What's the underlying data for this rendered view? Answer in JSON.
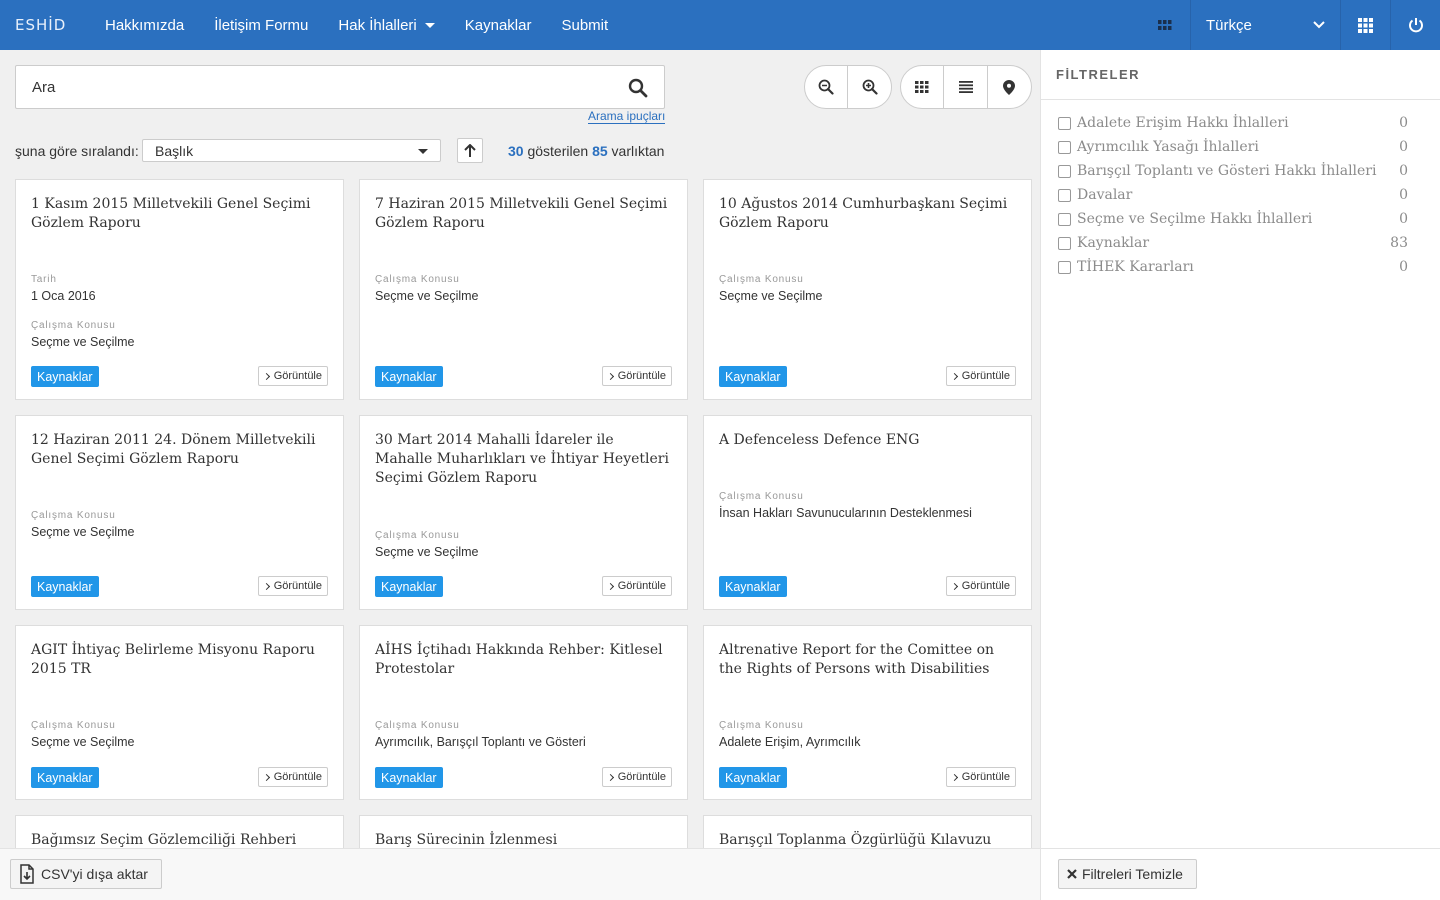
{
  "header": {
    "brand": "ESHİD",
    "nav": [
      "Hakkımızda",
      "İletişim Formu",
      "Hak İhlalleri",
      "Kaynaklar",
      "Submit"
    ],
    "language": "Türkçe",
    "icons": [
      "grid-small-icon",
      "chevron-down-icon",
      "apps-icon",
      "power-icon"
    ]
  },
  "search": {
    "placeholder": "Ara",
    "tips": "Arama ipuçları"
  },
  "sort": {
    "label": "şuna göre sıralandı:",
    "value": "Başlık"
  },
  "results": {
    "shown": "30",
    "mid": " gösterilen ",
    "total": "85",
    "suffix": " varlıktan"
  },
  "cards": [
    {
      "title": "1 Kasım 2015 Milletvekili Genel Seçimi Gözlem Raporu",
      "date_label": "Tarih",
      "date": "1 Oca 2016",
      "subject_label": "Çalışma Konusu",
      "subject": "Seçme ve Seçilme",
      "tag": "Kaynaklar",
      "view": "Görüntüle"
    },
    {
      "title": "7 Haziran 2015 Milletvekili Genel Seçimi Gözlem Raporu",
      "subject_label": "Çalışma Konusu",
      "subject": "Seçme ve Seçilme",
      "tag": "Kaynaklar",
      "view": "Görüntüle"
    },
    {
      "title": "10 Ağustos 2014 Cumhurbaşkanı Seçimi Gözlem Raporu",
      "subject_label": "Çalışma Konusu",
      "subject": "Seçme ve Seçilme",
      "tag": "Kaynaklar",
      "view": "Görüntüle"
    },
    {
      "title": "12 Haziran 2011 24. Dönem Milletvekili Genel Seçimi Gözlem Raporu",
      "subject_label": "Çalışma Konusu",
      "subject": "Seçme ve Seçilme",
      "tag": "Kaynaklar",
      "view": "Görüntüle"
    },
    {
      "title": "30 Mart 2014 Mahalli İdareler ile Mahalle Muharlıkları ve İhtiyar Heyetleri Seçimi Gözlem Raporu",
      "subject_label": "Çalışma Konusu",
      "subject": "Seçme ve Seçilme",
      "tag": "Kaynaklar",
      "view": "Görüntüle"
    },
    {
      "title": "A Defenceless Defence ENG",
      "subject_label": "Çalışma Konusu",
      "subject": "İnsan Hakları Savunucularının Desteklenmesi",
      "tag": "Kaynaklar",
      "view": "Görüntüle"
    },
    {
      "title": "AGIT İhtiyaç Belirleme Misyonu Raporu 2015 TR",
      "subject_label": "Çalışma Konusu",
      "subject": "Seçme ve Seçilme",
      "tag": "Kaynaklar",
      "view": "Görüntüle"
    },
    {
      "title": "AİHS İçtihadı Hakkında Rehber: Kitlesel Protestolar",
      "subject_label": "Çalışma Konusu",
      "subject": "Ayrımcılık, Barışçıl Toplantı ve Gösteri",
      "tag": "Kaynaklar",
      "view": "Görüntüle"
    },
    {
      "title": "Altrenative Report for the Comittee on the Rights of Persons with Disabilities",
      "subject_label": "Çalışma Konusu",
      "subject": "Adalete Erişim, Ayrımcılık",
      "tag": "Kaynaklar",
      "view": "Görüntüle"
    },
    {
      "title": "Bağımsız Seçim Gözlemciliği Rehberi"
    },
    {
      "title": "Barış Sürecinin İzlenmesi"
    },
    {
      "title": "Barışçıl Toplanma Özgürlüğü Kılavuzu"
    }
  ],
  "filters": {
    "heading": "FİLTRELER",
    "items": [
      {
        "label": "Adalete Erişim Hakkı İhlalleri",
        "count": "0"
      },
      {
        "label": "Ayrımcılık Yasağı İhlalleri",
        "count": "0"
      },
      {
        "label": "Barışçıl Toplantı ve Gösteri Hakkı İhlalleri",
        "count": "0"
      },
      {
        "label": "Davalar",
        "count": "0"
      },
      {
        "label": "Seçme ve Seçilme Hakkı İhlalleri",
        "count": "0"
      },
      {
        "label": "Kaynaklar",
        "count": "83"
      },
      {
        "label": "TİHEK Kararları",
        "count": "0"
      }
    ]
  },
  "footer": {
    "csv": "CSV'yi dışa aktar",
    "clear": "Filtreleri Temizle"
  },
  "colors": {
    "brand": "#2b70bf",
    "tag": "#2196e8"
  }
}
